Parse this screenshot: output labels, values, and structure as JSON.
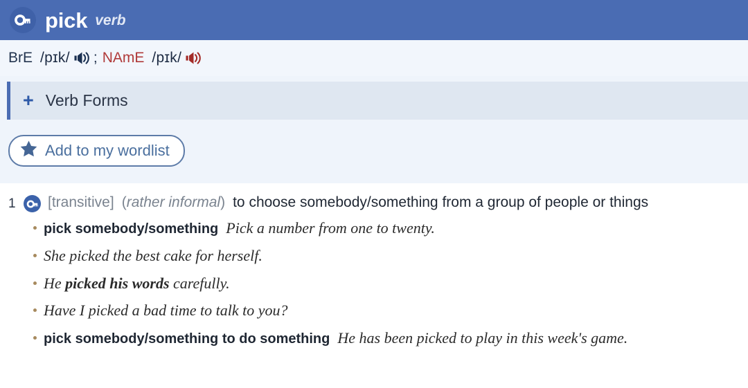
{
  "header": {
    "headword": "pick",
    "part_of_speech": "verb",
    "oxford_key_icon": "key-icon",
    "background_color": "#4a6cb3"
  },
  "pronunciation": {
    "bre_label": "BrE",
    "bre_phonetic": "/pɪk/",
    "bre_speaker_icon": "speaker-icon",
    "bre_speaker_color": "#1c3152",
    "separator": ";",
    "name_label": "NAmE",
    "name_phonetic": "/pɪk/",
    "name_speaker_icon": "speaker-icon",
    "name_speaker_color": "#a32b28"
  },
  "verb_forms": {
    "expand_icon": "plus-icon",
    "label": "Verb Forms"
  },
  "wordlist": {
    "star_icon": "star-icon",
    "label": "Add to my wordlist",
    "border_color": "#5d7ba8",
    "text_color": "#4a6f9e"
  },
  "senses": [
    {
      "number": "1",
      "key_icon": "key-icon",
      "grammar": "[transitive]",
      "register_open": "(",
      "register": "rather informal",
      "register_close": ")",
      "definition": "to choose somebody/something from a group of people or things",
      "examples": [
        {
          "pattern": "pick somebody/something",
          "text": "Pick a number from one to twenty."
        },
        {
          "pattern": "",
          "text_pre": "She picked the best cake for herself.",
          "text_bold": "",
          "text_post": ""
        },
        {
          "pattern": "",
          "text_pre": "He ",
          "text_bold": "picked his words",
          "text_post": " carefully."
        },
        {
          "pattern": "",
          "text_pre": "Have I picked a bad time to talk to you?",
          "text_bold": "",
          "text_post": ""
        },
        {
          "pattern": "pick somebody/something to do something",
          "text": "He has been picked to play in this week's game."
        }
      ]
    }
  ]
}
